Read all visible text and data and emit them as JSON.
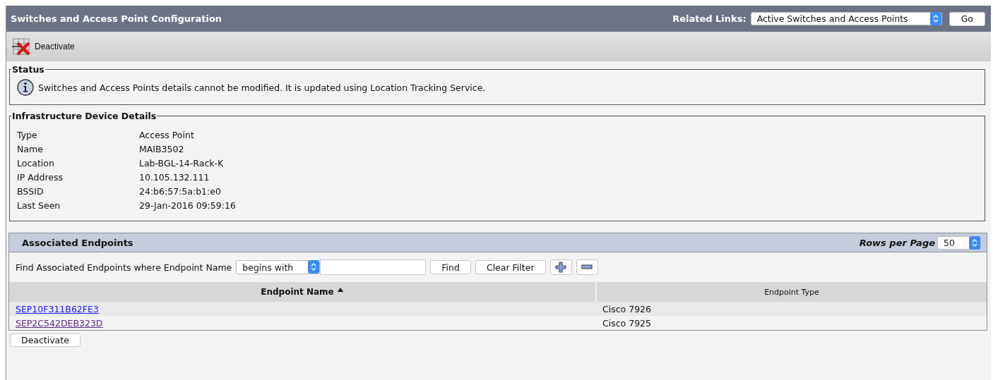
{
  "header": {
    "title": "Switches and Access Point Configuration",
    "related_links_label": "Related Links:",
    "related_links_value": "Active Switches and Access Points",
    "go_button": "Go"
  },
  "toolbar": {
    "deactivate_label": "Deactivate"
  },
  "status": {
    "legend": "Status",
    "message": "Switches and Access Points details cannot be modified. It is updated using Location Tracking Service."
  },
  "details": {
    "legend": "Infrastructure Device Details",
    "fields": [
      {
        "label": "Type",
        "value": "Access Point"
      },
      {
        "label": "Name",
        "value": "MAIB3502"
      },
      {
        "label": "Location",
        "value": "Lab-BGL-14-Rack-K"
      },
      {
        "label": "IP Address",
        "value": "10.105.132.111"
      },
      {
        "label": "BSSID",
        "value": "24:b6:57:5a:b1:e0"
      },
      {
        "label": "Last Seen",
        "value": "29-Jan-2016 09:59:16"
      }
    ]
  },
  "endpoints": {
    "title": "Associated Endpoints",
    "rows_per_page_label": "Rows per Page",
    "rows_per_page": "50",
    "filter": {
      "label": "Find Associated Endpoints where Endpoint Name",
      "operator": "begins with",
      "find_button": "Find",
      "clear_button": "Clear Filter"
    },
    "table": {
      "columns": [
        {
          "label": "Endpoint Name",
          "sorted": true
        },
        {
          "label": "Endpoint Type",
          "sorted": false
        }
      ],
      "rows": [
        {
          "name": "SEP10F311B62FE3",
          "visited": false,
          "type": "Cisco 7926"
        },
        {
          "name": "SEP2C542DEB323D",
          "visited": true,
          "type": "Cisco 7925"
        }
      ]
    },
    "deactivate_button": "Deactivate"
  }
}
